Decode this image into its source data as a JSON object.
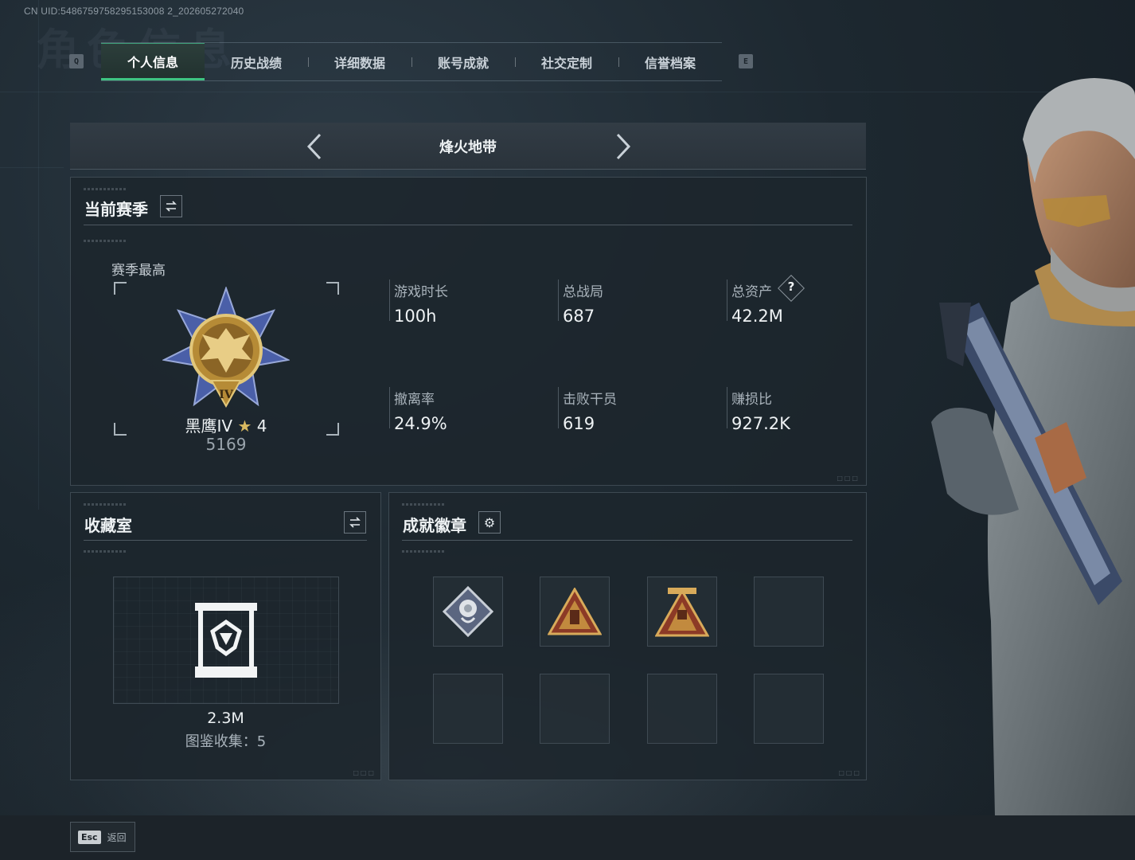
{
  "header": {
    "uid": "CN UID:5486759758295153008 2_202605272040",
    "bg_title": "角色信息"
  },
  "tabs": {
    "left_key": "Q",
    "right_key": "E",
    "items": [
      {
        "label": "个人信息",
        "active": true
      },
      {
        "label": "历史战绩",
        "active": false
      },
      {
        "label": "详细数据",
        "active": false
      },
      {
        "label": "账号成就",
        "active": false
      },
      {
        "label": "社交定制",
        "active": false
      },
      {
        "label": "信誉档案",
        "active": false
      }
    ]
  },
  "mode": {
    "title": "烽火地带"
  },
  "season": {
    "title": "当前赛季",
    "best_label": "赛季最高",
    "rank_name": "黑鹰IV",
    "rank_stars": "4",
    "rank_points": "5169",
    "stats": [
      {
        "label": "游戏时长",
        "value": "100h"
      },
      {
        "label": "总战局",
        "value": "687"
      },
      {
        "label": "总资产",
        "value": "42.2M",
        "help": "?"
      },
      {
        "label": "撤离率",
        "value": "24.9%"
      },
      {
        "label": "击败干员",
        "value": "619"
      },
      {
        "label": "赚损比",
        "value": "927.2K"
      }
    ]
  },
  "collection": {
    "title": "收藏室",
    "value": "2.3M",
    "catalog": "图鉴收集：5"
  },
  "badges": {
    "title": "成就徽章",
    "slots": [
      {
        "icon": "rose-badge-icon",
        "filled": true
      },
      {
        "icon": "fist-triangle-badge-icon",
        "filled": true
      },
      {
        "icon": "tower-triangle-badge-icon",
        "filled": true
      },
      {
        "icon": "",
        "filled": false
      },
      {
        "icon": "",
        "filled": false
      },
      {
        "icon": "",
        "filled": false
      },
      {
        "icon": "",
        "filled": false
      },
      {
        "icon": "",
        "filled": false
      }
    ]
  },
  "footer": {
    "esc_key": "Esc",
    "back_label": "返回"
  },
  "colors": {
    "accent_green": "#3ec482",
    "rank_gold": "#c9a24a",
    "rank_blue": "#4a5fa8"
  }
}
